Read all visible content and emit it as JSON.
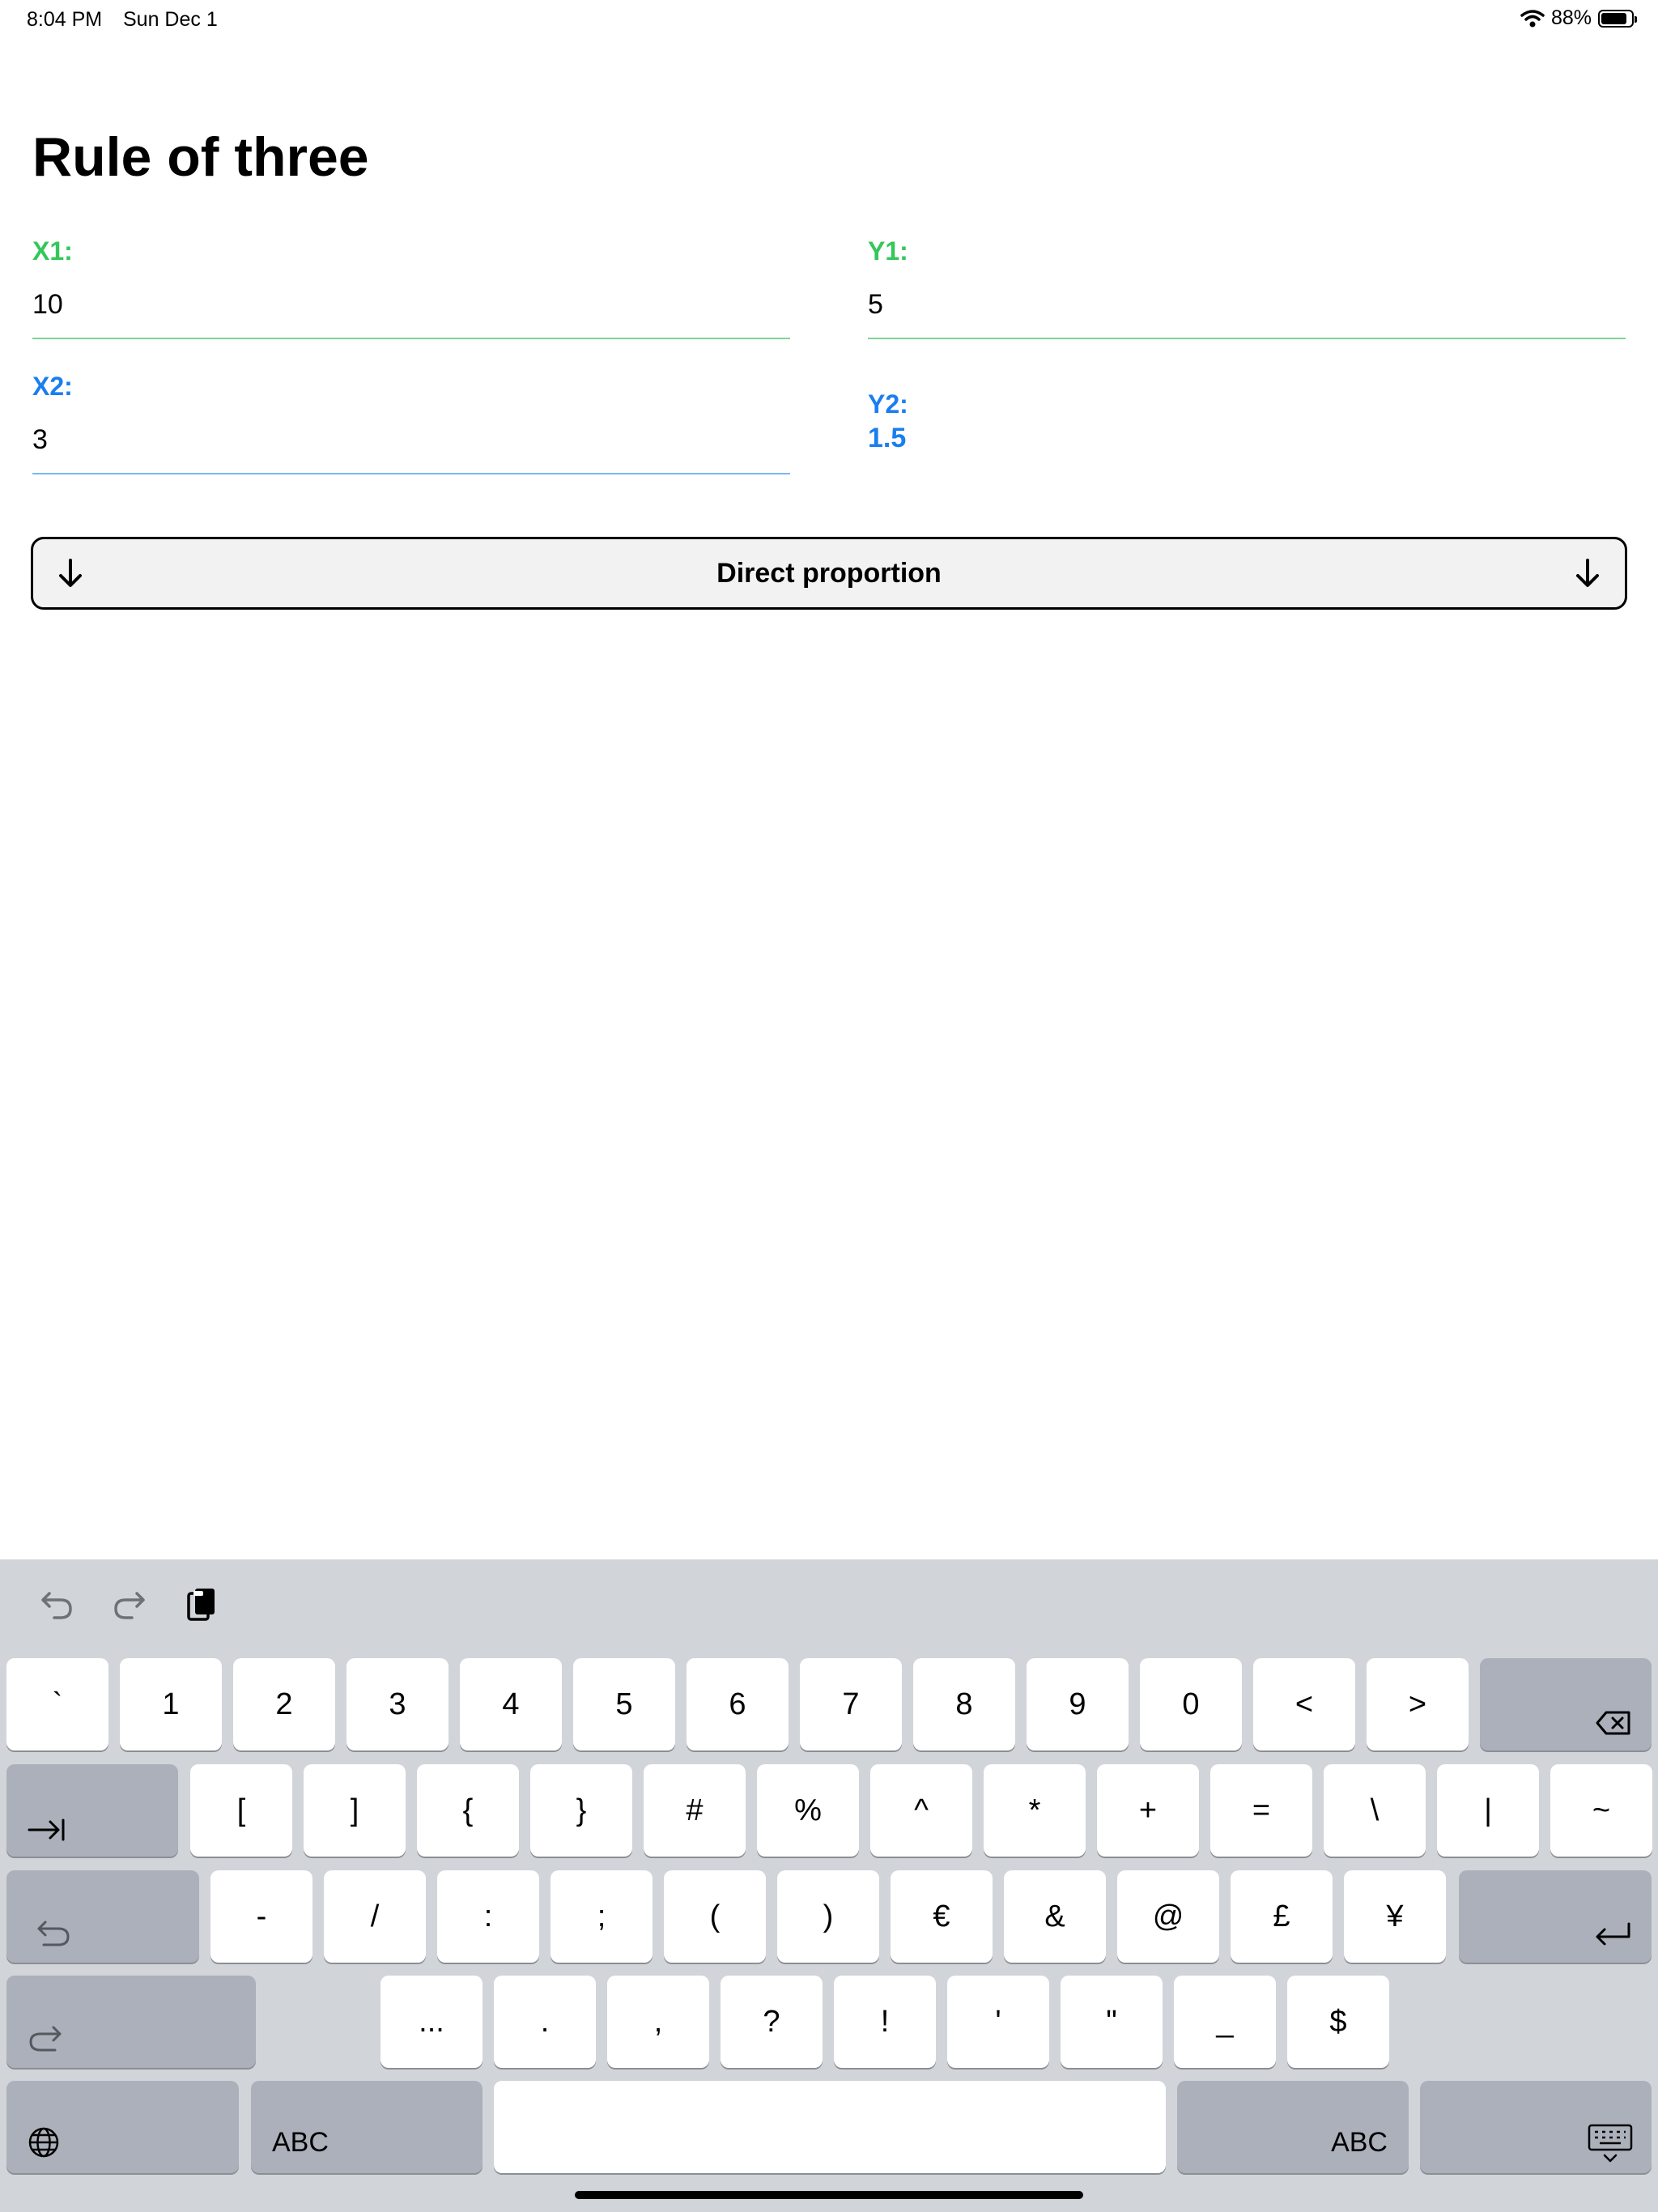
{
  "status_bar": {
    "time": "8:04 PM",
    "date": "Sun Dec 1",
    "battery": "88%",
    "battery_level": 0.88
  },
  "page": {
    "title": "Rule of three"
  },
  "fields": {
    "x1": {
      "label": "X1:",
      "value": "10"
    },
    "y1": {
      "label": "Y1:",
      "value": "5"
    },
    "x2": {
      "label": "X2:",
      "value": "3"
    },
    "y2": {
      "label": "Y2:",
      "value": "1.5"
    }
  },
  "proportion_button": {
    "label": "Direct proportion"
  },
  "colors": {
    "green": "#34c759",
    "blue": "#1a7ef0",
    "keyboard_bg": "#d1d4d9",
    "key_dark": "#abb0ba"
  },
  "keyboard": {
    "row1": [
      "`",
      "1",
      "2",
      "3",
      "4",
      "5",
      "6",
      "7",
      "8",
      "9",
      "0",
      "<",
      ">"
    ],
    "row2": [
      "[",
      "]",
      "{",
      "}",
      "#",
      "%",
      "^",
      "*",
      "+",
      "=",
      "\\",
      "|",
      "~"
    ],
    "row3": [
      "-",
      "/",
      ":",
      ";",
      "(",
      ")",
      "€",
      "&",
      "@",
      "£",
      "¥"
    ],
    "row4": [
      "...",
      ".",
      ",",
      "?",
      "!",
      "'",
      "\"",
      "_",
      "$"
    ],
    "abc_left": "ABC",
    "abc_right": "ABC",
    "icons": [
      "undo-icon",
      "redo-icon",
      "clipboard-icon",
      "delete-icon",
      "tab-icon",
      "undo-key-icon",
      "return-icon",
      "redo-key-icon",
      "globe-icon",
      "keyboard-dismiss-icon"
    ]
  }
}
